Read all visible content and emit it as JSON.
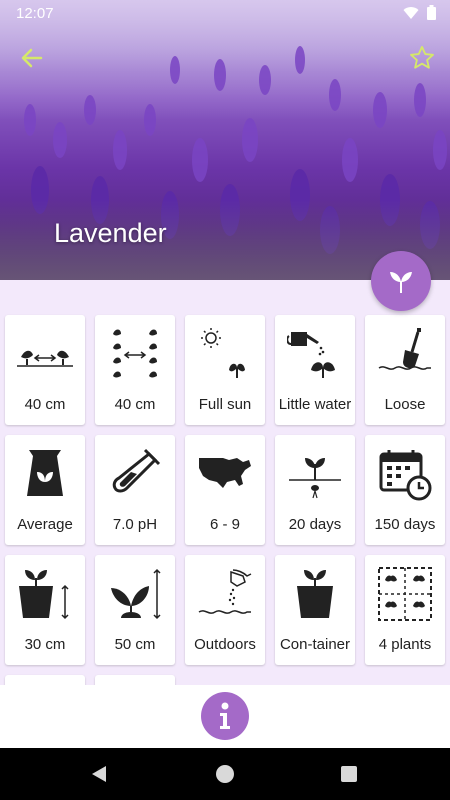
{
  "status": {
    "time": "12:07"
  },
  "plant": {
    "name": "Lavender"
  },
  "colors": {
    "accent": "#a46ac8",
    "background": "#f3e9fb"
  },
  "tiles": [
    {
      "icon": "plant-spacing-icon",
      "label": "40 cm"
    },
    {
      "icon": "row-spacing-icon",
      "label": "40 cm"
    },
    {
      "icon": "full-sun-icon",
      "label": "Full sun"
    },
    {
      "icon": "watering-can-icon",
      "label": "Little water"
    },
    {
      "icon": "shovel-icon",
      "label": "Loose"
    },
    {
      "icon": "soil-bag-icon",
      "label": "Average"
    },
    {
      "icon": "test-tube-icon",
      "label": "7.0 pH"
    },
    {
      "icon": "usa-map-icon",
      "label": "6 - 9"
    },
    {
      "icon": "sprouting-seed-icon",
      "label": "20 days"
    },
    {
      "icon": "calendar-clock-icon",
      "label": "150 days"
    },
    {
      "icon": "pot-depth-icon",
      "label": "30 cm"
    },
    {
      "icon": "plant-height-icon",
      "label": "50 cm"
    },
    {
      "icon": "sowing-hand-icon",
      "label": "Outdoors"
    },
    {
      "icon": "container-pot-icon",
      "label": "Con-tainer"
    },
    {
      "icon": "plants-per-area-icon",
      "label": "4 plants"
    }
  ]
}
